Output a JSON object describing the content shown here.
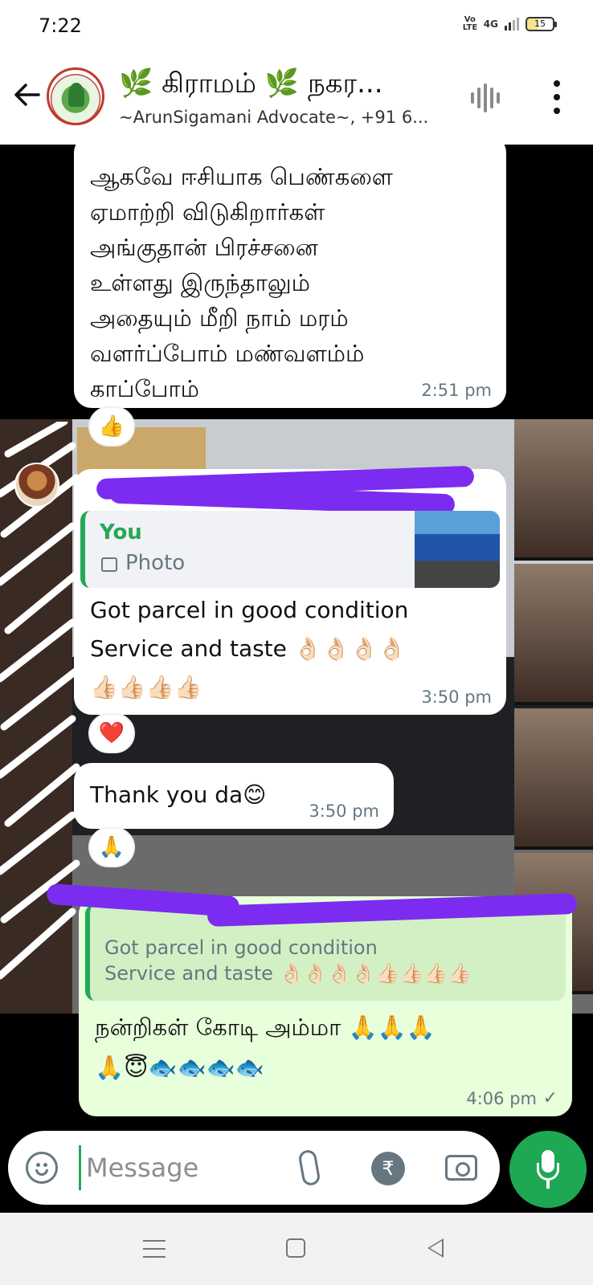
{
  "status_bar": {
    "time": "7:22",
    "volte": "Vo LTE",
    "network": "4G",
    "battery": "15"
  },
  "header": {
    "title": "🌿 கிராமம் 🌿 நகர...",
    "subtitle": "~ArunSigamani Advocate~, +91 6...",
    "icons": [
      "back-arrow-icon",
      "voice-chat-icon",
      "more-options-icon"
    ]
  },
  "messages": [
    {
      "type": "incoming",
      "text": "ஆகவே ஈசியாக பெண்களை\nஏமாற்றி விடுகிறார்கள்\nஅங்குதான் பிரச்சனை\nஉள்ளது இருந்தாலும்\nஅதையும் மீறி நாம் மரம்\nவளர்ப்போம் மண்வளம்ம்\nகாப்போம்",
      "time": "2:51 pm",
      "reaction": "👍"
    },
    {
      "type": "incoming",
      "quote_name": "You",
      "quote_text": "Photo",
      "text": "Got parcel in good condition\nService and taste 👌🏻👌🏻👌🏻👌🏻\n👍🏻👍🏻👍🏻👍🏻",
      "time": "3:50 pm",
      "reaction": "❤️"
    },
    {
      "type": "incoming",
      "text": "Thank you da😊",
      "time": "3:50 pm",
      "reaction": "🙏"
    },
    {
      "type": "outgoing",
      "quote_text": "Got parcel in good condition\nService and taste 👌🏻👌🏻👌🏻👌🏻👍🏻👍🏻👍🏻👍🏻",
      "text": "நன்றிகள் கோடி அம்மா 🙏🙏🙏\n🙏😇🐟🐟🐟🐟",
      "time": "4:06 pm",
      "status": "✓"
    }
  ],
  "input": {
    "placeholder": "Message",
    "rupee": "₹"
  },
  "colors": {
    "accent": "#1ea854",
    "incoming": "#ffffff",
    "outgoing": "#e7ffdb",
    "redaction": "#7b2cf0"
  }
}
